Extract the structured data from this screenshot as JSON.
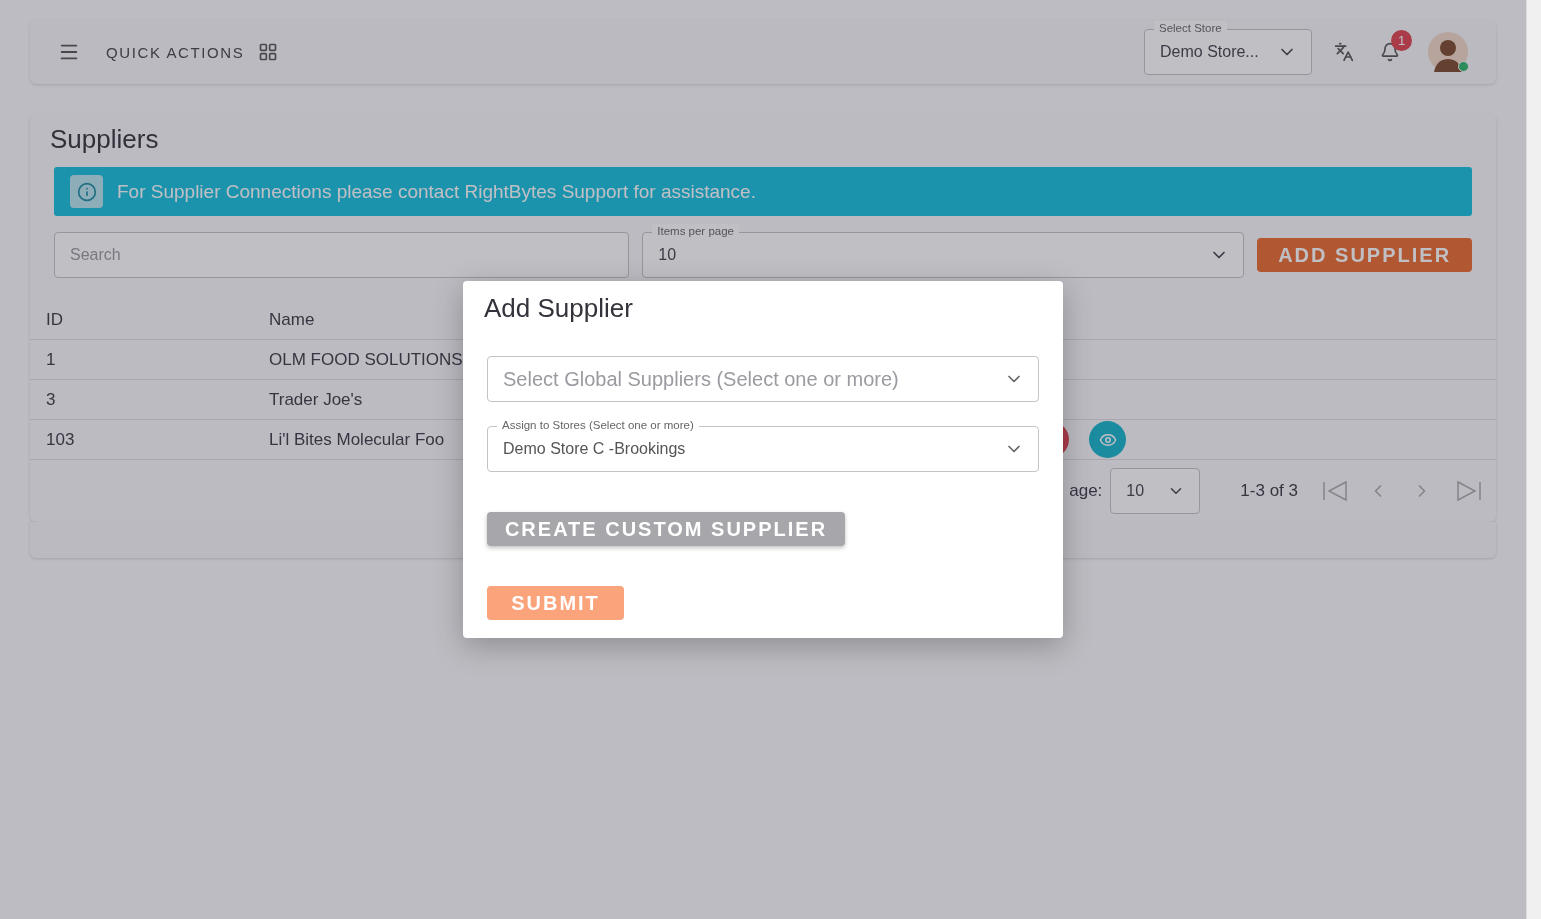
{
  "topbar": {
    "quick_actions": "QUICK ACTIONS",
    "store_select": {
      "label": "Select Store",
      "value": "Demo Store..."
    },
    "notifications": "1"
  },
  "page": {
    "title": "Suppliers",
    "info": "For Supplier Connections please contact RightBytes Support for assistance.",
    "search": {
      "placeholder": "Search"
    },
    "items_per_page": {
      "label": "Items per page",
      "value": "10"
    },
    "add_button": "ADD SUPPLIER"
  },
  "table": {
    "columns": [
      "ID",
      "Name"
    ],
    "rows": [
      {
        "cells": [
          "1",
          "OLM FOOD SOLUTIONS"
        ],
        "actions": false
      },
      {
        "cells": [
          "3",
          "Trader Joe's"
        ],
        "actions": false
      },
      {
        "cells": [
          "103",
          "Li'l Bites Molecular Foo"
        ],
        "actions": true
      }
    ]
  },
  "pagination": {
    "rows_label": "age:",
    "per_page": "10",
    "range": "1-3 of 3"
  },
  "dialog": {
    "title": "Add Supplier",
    "global_select": {
      "placeholder": "Select Global Suppliers (Select one or more)"
    },
    "stores_select": {
      "label": "Assign to Stores (Select one or more)",
      "value": "Demo Store C -Brookings"
    },
    "custom_button": "CREATE CUSTOM SUPPLIER",
    "submit": {
      "label": "SUBMIT",
      "disabled": true
    }
  }
}
